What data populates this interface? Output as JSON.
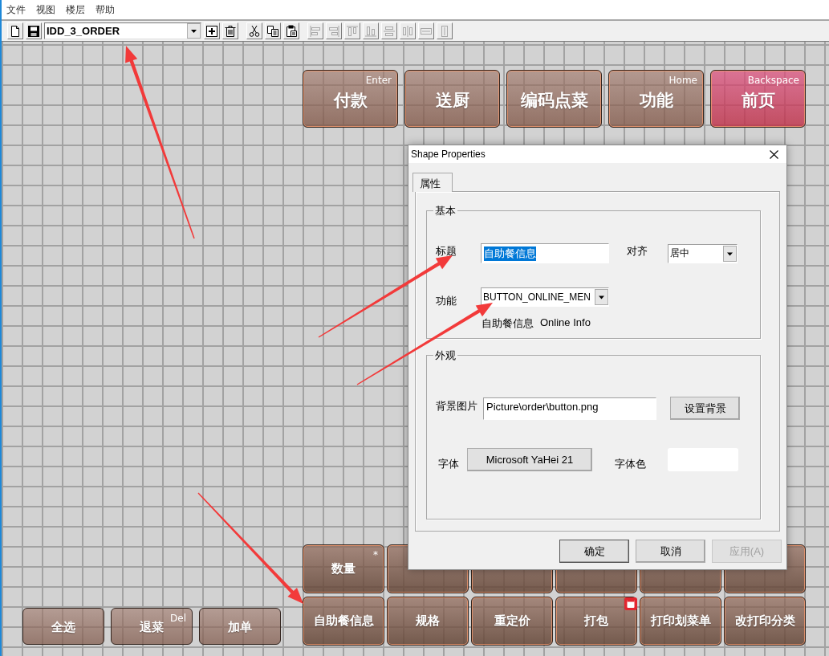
{
  "menu": [
    {
      "label": "文件"
    },
    {
      "label": "视图"
    },
    {
      "label": "楼层"
    },
    {
      "label": "帮助"
    }
  ],
  "toolbar": {
    "groups": [
      {
        "items": [
          {
            "kind": "new",
            "disabled": false
          },
          {
            "kind": "save",
            "disabled": false
          },
          {
            "kind": "dropdown",
            "value": "IDD_3_ORDER",
            "disabled": false
          },
          {
            "kind": "add",
            "disabled": false
          },
          {
            "kind": "delete",
            "disabled": false
          }
        ]
      },
      {
        "items": [
          {
            "kind": "cut",
            "disabled": false
          },
          {
            "kind": "copy",
            "disabled": false
          },
          {
            "kind": "paste",
            "disabled": false
          }
        ]
      },
      {
        "items": [
          {
            "kind": "left",
            "disabled": true
          },
          {
            "kind": "right",
            "disabled": true
          },
          {
            "kind": "top",
            "disabled": true
          },
          {
            "kind": "bottom",
            "disabled": true
          },
          {
            "kind": "middle",
            "disabled": true
          },
          {
            "kind": "center",
            "disabled": true
          },
          {
            "kind": "width",
            "disabled": true
          },
          {
            "kind": "height",
            "disabled": true
          }
        ]
      }
    ]
  },
  "canvas": {
    "top_buttons": [
      {
        "label": "付款",
        "hotkey": "Enter",
        "kind": "normal"
      },
      {
        "label": "送厨",
        "kind": "normal"
      },
      {
        "label": "编码点菜",
        "kind": "normal"
      },
      {
        "label": "功能",
        "hotkey": "Home",
        "kind": "normal"
      },
      {
        "label": "前页",
        "hotkey": "Backspace",
        "kind": "accent"
      }
    ],
    "left_buttons": [
      {
        "label": "全选"
      },
      {
        "label": "退菜",
        "hotkey": "Del"
      },
      {
        "label": "加单"
      }
    ],
    "grid_buttons": [
      [
        {
          "label": "数量",
          "hotkey": "*",
          "marked": false
        },
        {
          "marked": false
        },
        {
          "marked": false
        },
        {
          "marked": false
        },
        {
          "marked": false
        },
        {
          "marked": false
        }
      ],
      [
        {
          "label": "自助餐信息",
          "marked": false
        },
        {
          "label": "规格",
          "marked": false
        },
        {
          "label": "重定价",
          "marked": false
        },
        {
          "label": "打包",
          "marked": true
        },
        {
          "label": "打印划菜单",
          "marked": false
        },
        {
          "label": "改打印分类",
          "marked": false
        }
      ]
    ]
  },
  "dialog": {
    "title": "Shape Properties",
    "tabs": [
      {
        "label": "属性",
        "selected": true
      }
    ],
    "basic": {
      "title": "基本",
      "caption_label": "标题",
      "caption": {
        "value": "自助餐信息",
        "text_selected": true
      },
      "align_label": "对齐",
      "align_value": "居中",
      "function_label": "功能",
      "function_value": "BUTTON_ONLINE_MEN",
      "function_description": [
        "自助餐信息",
        "Online Info"
      ]
    },
    "appearance": {
      "title": "外观",
      "background_label": "背景图片",
      "background_value": "Picture\\order\\button.png",
      "background_button": "设置背景",
      "font_label": "字体",
      "font_button": "Microsoft YaHei 21",
      "font_color_label": "字体色"
    },
    "buttons": [
      {
        "label": "确定",
        "disabled": false
      },
      {
        "label": "取消",
        "disabled": false
      },
      {
        "label": "应用(A)",
        "disabled": true
      }
    ]
  }
}
